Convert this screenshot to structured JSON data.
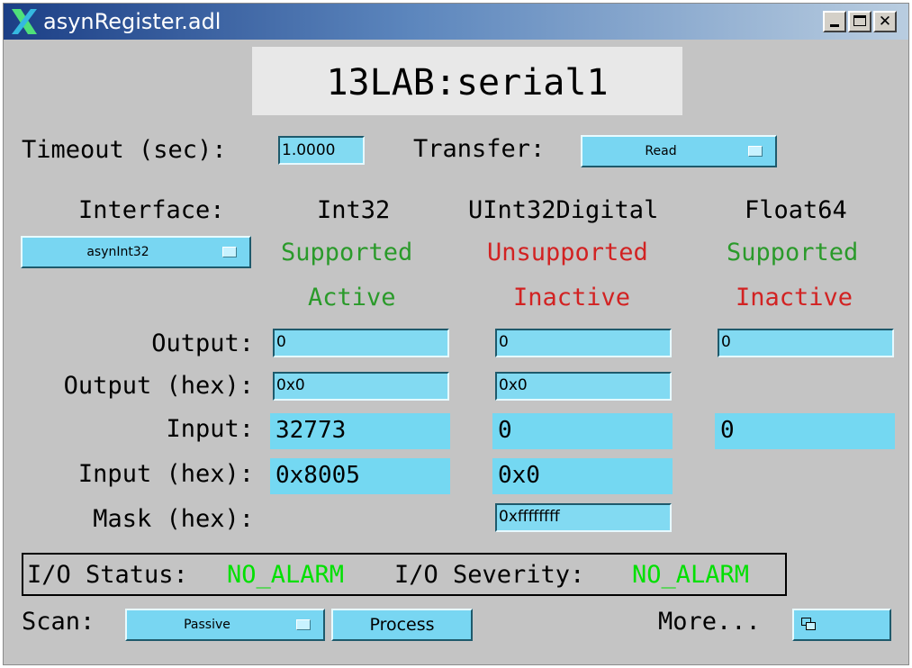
{
  "window": {
    "title": "asynRegister.adl"
  },
  "header": {
    "pv_name": "13LAB:serial1"
  },
  "timeout": {
    "label": "Timeout (sec):",
    "value": "1.0000"
  },
  "transfer": {
    "label": "Transfer:",
    "value": "Read"
  },
  "interface": {
    "label": "Interface:",
    "selected": "asynInt32",
    "columns": [
      {
        "name": "Int32",
        "support": "Supported",
        "state": "Active"
      },
      {
        "name": "UInt32Digital",
        "support": "Unsupported",
        "state": "Inactive"
      },
      {
        "name": "Float64",
        "support": "Supported",
        "state": "Inactive"
      }
    ]
  },
  "rows": {
    "output_label": "Output:",
    "output_hex_label": "Output (hex):",
    "input_label": "Input:",
    "input_hex_label": "Input (hex):",
    "mask_hex_label": "Mask (hex):"
  },
  "int32": {
    "output": "0",
    "output_hex": "0x0",
    "input": "32773",
    "input_hex": "0x8005"
  },
  "uint32": {
    "output": "0",
    "output_hex": "0x0",
    "input": "0",
    "input_hex": "0x0",
    "mask_hex": "0xffffffff"
  },
  "float64": {
    "output": "0",
    "input": "0"
  },
  "status": {
    "io_status_label": "I/O Status:",
    "io_status": "NO_ALARM",
    "io_severity_label": "I/O Severity:",
    "io_severity": "NO_ALARM"
  },
  "footer": {
    "scan_label": "Scan:",
    "scan_value": "Passive",
    "process_label": "Process",
    "more_label": "More...",
    "more_icon": "windows-icon"
  },
  "colors": {
    "background": "#c4c4c4",
    "field": "#82daf2",
    "supported": "#2a9a2a",
    "unsupported": "#d22222",
    "alarm_ok": "#00e000"
  }
}
